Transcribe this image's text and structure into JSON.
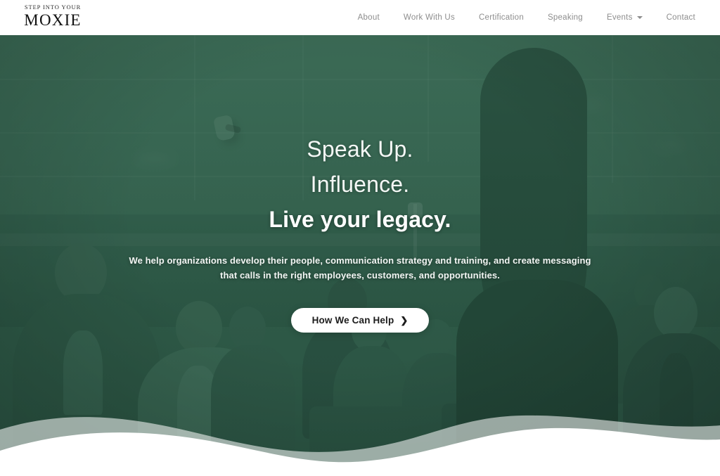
{
  "header": {
    "logo": {
      "tagline": "STEP INTO YOUR",
      "brand": "MOXIE",
      "name": "moxie-logo"
    },
    "nav": [
      {
        "label": "About",
        "has_dropdown": false
      },
      {
        "label": "Work With Us",
        "has_dropdown": false
      },
      {
        "label": "Certification",
        "has_dropdown": false
      },
      {
        "label": "Speaking",
        "has_dropdown": false
      },
      {
        "label": "Events",
        "has_dropdown": true
      },
      {
        "label": "Contact",
        "has_dropdown": false
      }
    ]
  },
  "hero": {
    "headline_line1": "Speak Up.",
    "headline_line2": "Influence.",
    "headline_line3": "Live your legacy.",
    "subtext": "We help organizations develop their people, communication strategy and training, and create messaging that calls in the right employees, customers, and opportunities.",
    "cta_label": "How We Can Help",
    "cta_chevron": "❯",
    "background_description": "Conference room audience seated facing a female speaker shown from behind, duotone green photo treatment"
  },
  "colors": {
    "hero_overlay_green": "#3a6a55",
    "hero_deep_green": "#28503f",
    "silhouette_dark": "#1b3a2d",
    "header_background": "#ffffff",
    "nav_text": "#8d8d8d",
    "logo_text": "#111111",
    "cta_background": "#ffffff",
    "cta_text": "#1c1c1c",
    "hero_text": "#ffffff",
    "wave_back": "rgba(255,255,255,0.55)",
    "wave_front": "#ffffff",
    "page_background": "#ffffff"
  }
}
